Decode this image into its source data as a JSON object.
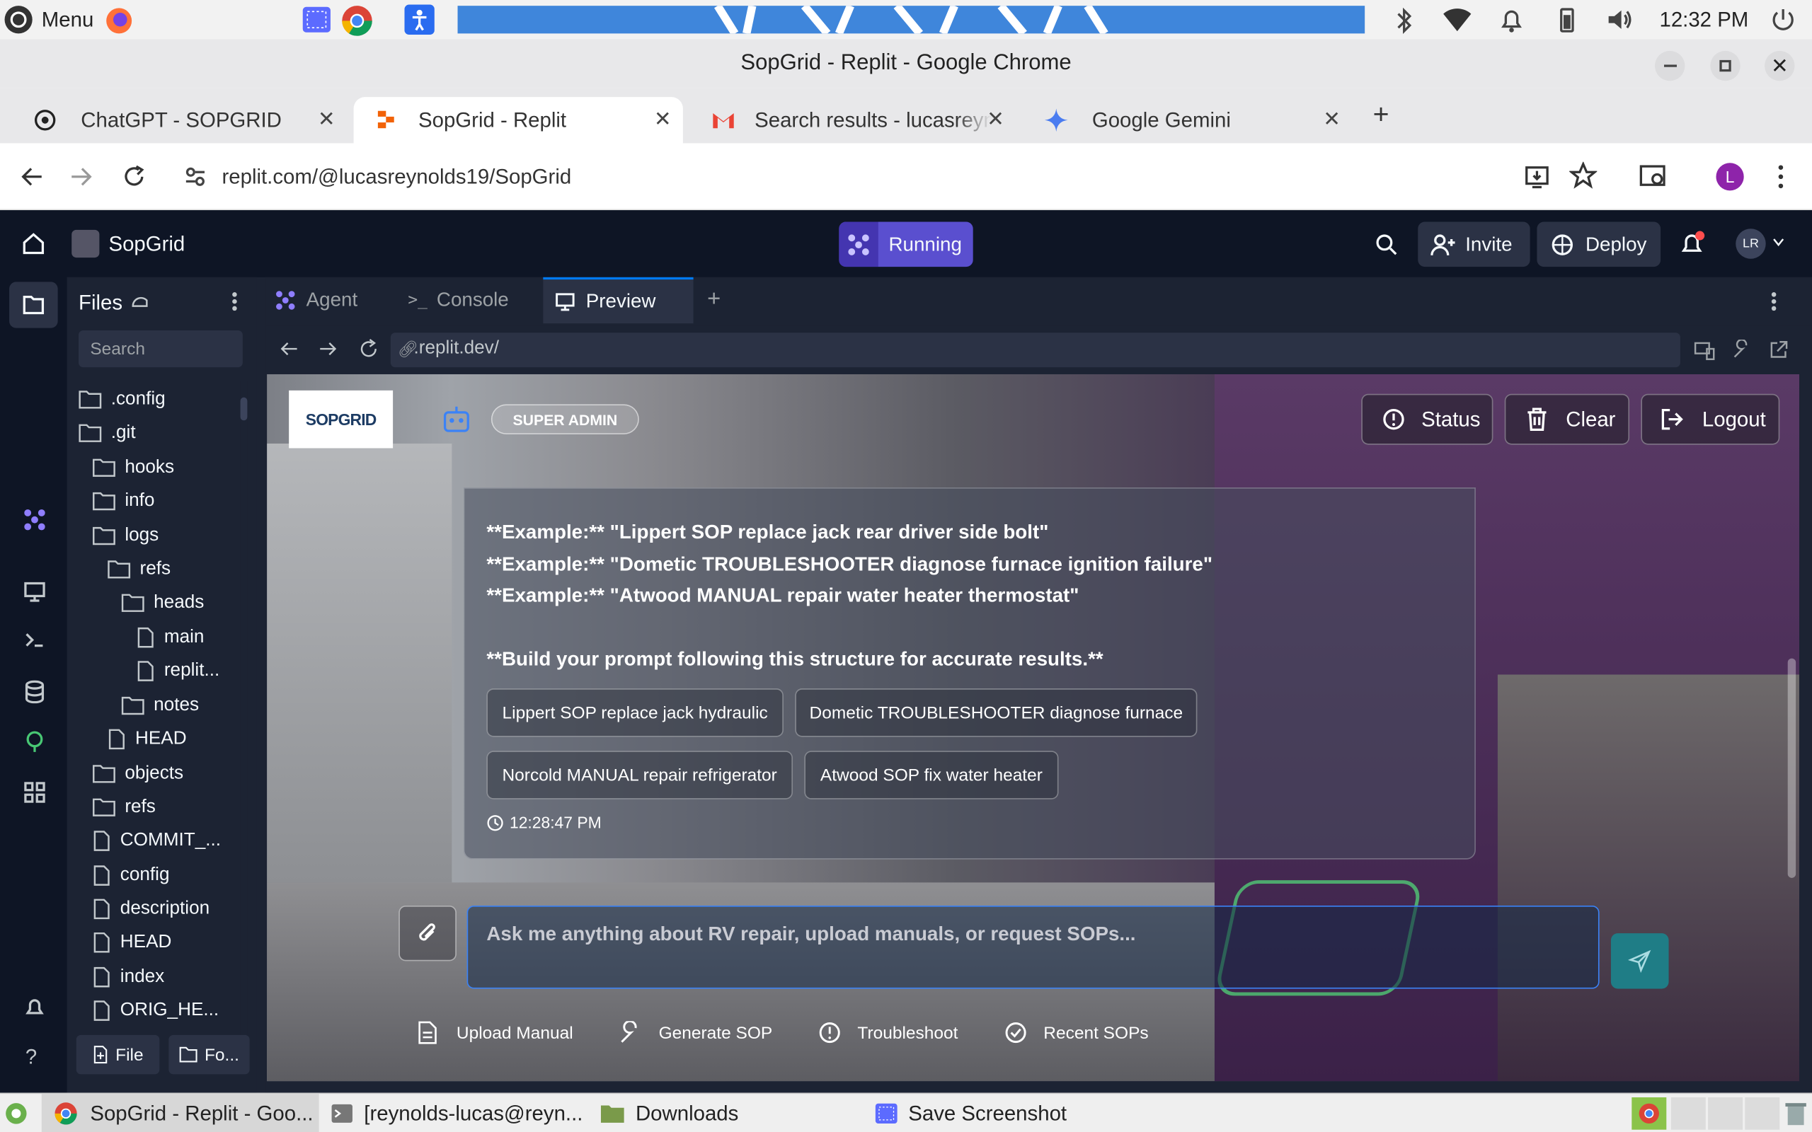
{
  "os": {
    "menu_label": "Menu",
    "clock": "12:32 PM"
  },
  "window": {
    "title": "SopGrid - Replit - Google Chrome"
  },
  "tabs": [
    {
      "label": "ChatGPT - SOPGRID"
    },
    {
      "label": "SopGrid - Replit"
    },
    {
      "label": "Search results - lucasreyn"
    },
    {
      "label": "Google Gemini"
    }
  ],
  "address": {
    "url": "replit.com/@lucasreynolds19/SopGrid",
    "profile": "L"
  },
  "replit": {
    "project": "SopGrid",
    "run_status": "Running",
    "invite": "Invite",
    "deploy": "Deploy",
    "avatar": "LR",
    "files_title": "Files",
    "search_placeholder": "Search",
    "tree": [
      ".config",
      ".git",
      "hooks",
      "info",
      "logs",
      "refs",
      "heads",
      "main",
      "replit...",
      "notes",
      "HEAD",
      "objects",
      "refs",
      "COMMIT_...",
      "config",
      "description",
      "HEAD",
      "index",
      "ORIG_HE..."
    ],
    "file_btn": "File",
    "folder_btn": "Fo...",
    "tool_tabs": [
      "Agent",
      "Console",
      "Preview"
    ],
    "preview_url": ".replit.dev/"
  },
  "app": {
    "logo": "SOPGRID",
    "role_badge": "SUPER ADMIN",
    "status_btn": "Status",
    "clear_btn": "Clear",
    "logout_btn": "Logout",
    "message_lines": [
      "**Example:** \"Lippert SOP replace jack rear driver side bolt\"",
      "**Example:** \"Dometic TROUBLESHOOTER diagnose furnace ignition failure\"",
      "**Example:** \"Atwood MANUAL repair water heater thermostat\""
    ],
    "message_footer": "**Build your prompt following this structure for accurate results.**",
    "suggestions": [
      "Lippert SOP replace jack hydraulic",
      "Dometic TROUBLESHOOTER diagnose furnace",
      "Norcold MANUAL repair refrigerator",
      "Atwood SOP fix water heater"
    ],
    "timestamp": "12:28:47 PM",
    "input_placeholder": "Ask me anything about RV repair, upload manuals, or request SOPs...",
    "actions": [
      "Upload Manual",
      "Generate SOP",
      "Troubleshoot",
      "Recent SOPs"
    ]
  },
  "taskbar": {
    "items": [
      "SopGrid - Replit - Goo...",
      "[reynolds-lucas@reyn...",
      "Downloads",
      "Save Screenshot"
    ]
  },
  "colors": {
    "accent": "#5a4fcf",
    "send": "#1f7d86",
    "chrome_bg": "#e8e8ea",
    "replit_bg": "#1c2333"
  }
}
